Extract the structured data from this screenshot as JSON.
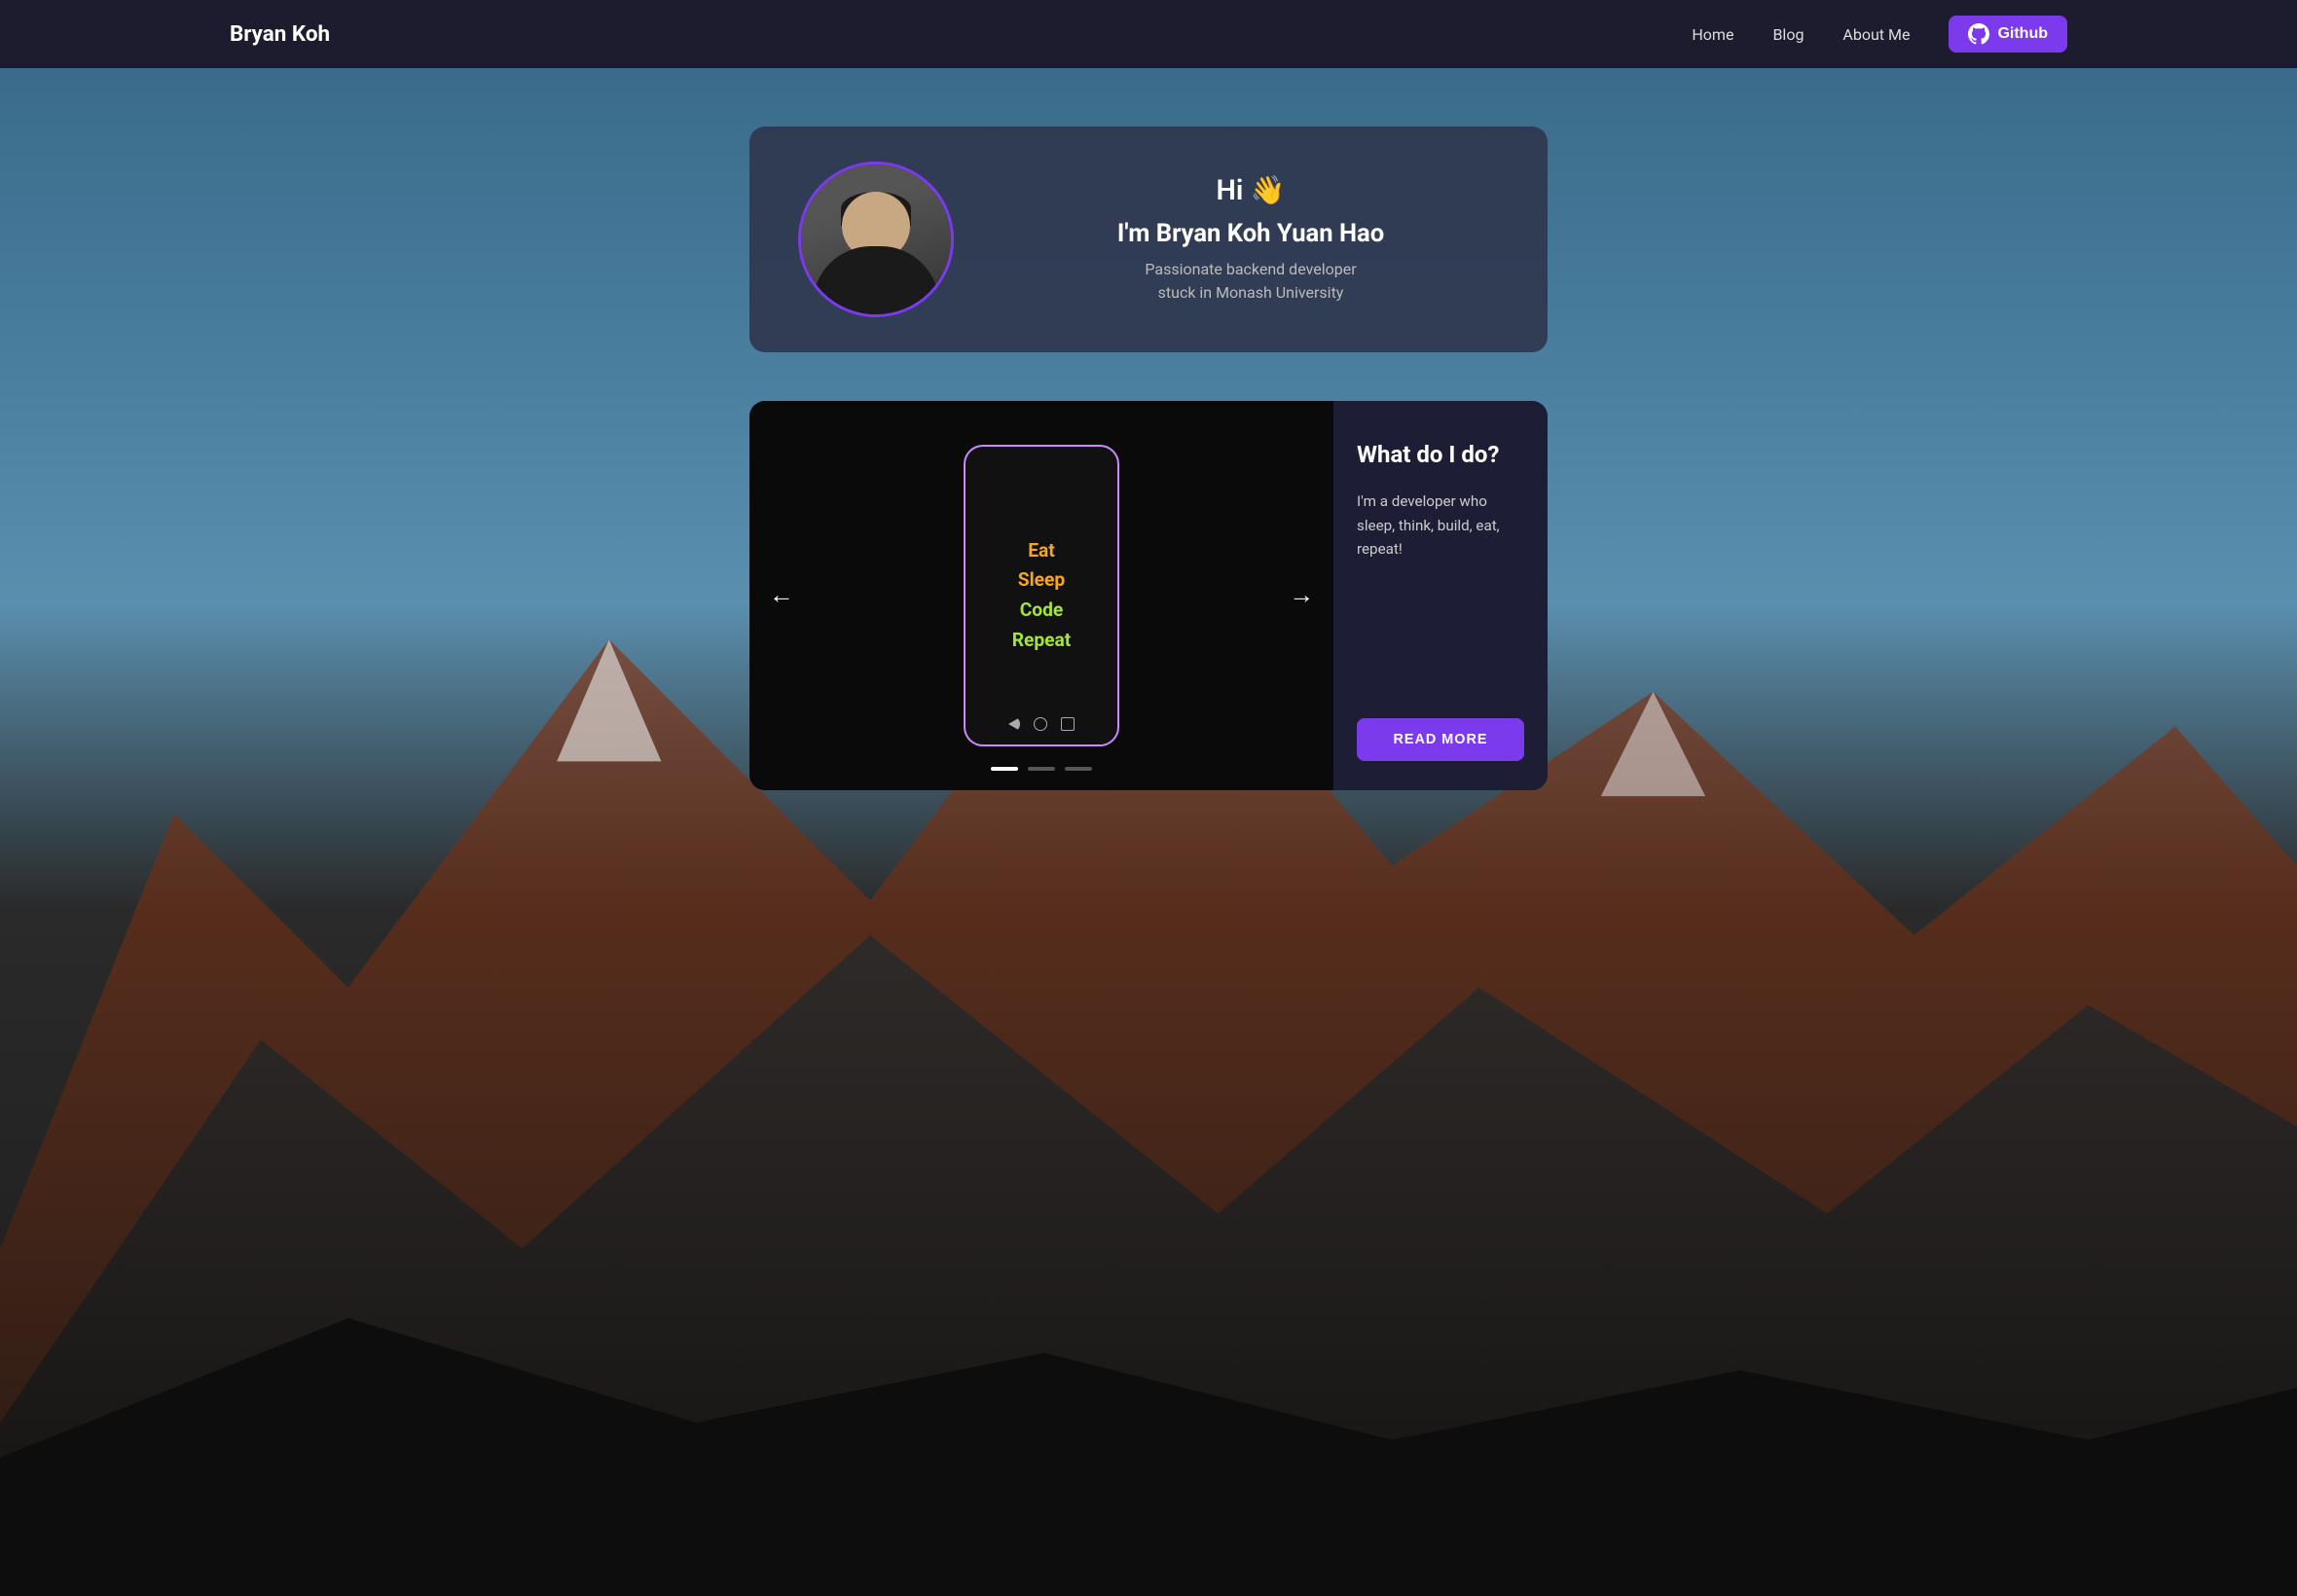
{
  "nav": {
    "brand": "Bryan Koh",
    "links": [
      {
        "label": "Home",
        "id": "home"
      },
      {
        "label": "Blog",
        "id": "blog"
      },
      {
        "label": "About Me",
        "id": "about"
      }
    ],
    "github_label": "Github"
  },
  "intro": {
    "greeting": "Hi 👋",
    "name": "I'm Bryan Koh Yuan Hao",
    "subtitle_line1": "Passionate backend developer",
    "subtitle_line2": "stuck in Monash University"
  },
  "carousel": {
    "phone_lines": [
      "Eat",
      "Sleep",
      "Code",
      "Repeat"
    ],
    "dots": [
      "active",
      "inactive",
      "inactive"
    ],
    "arrow_left": "←",
    "arrow_right": "→"
  },
  "info_panel": {
    "title": "What do I do?",
    "description": "I'm a developer who sleep, think, build, eat, repeat!",
    "read_more_label": "READ MORE"
  }
}
